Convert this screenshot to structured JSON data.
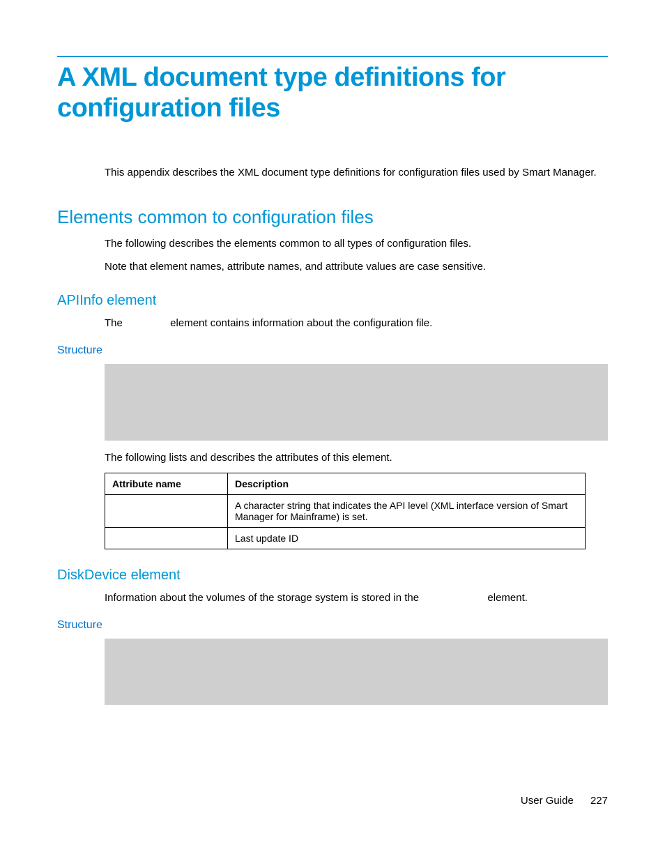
{
  "title": "A XML document type definitions for configuration files",
  "intro": "This appendix describes the XML document type definitions for configuration files used by Smart Manager.",
  "section1": {
    "heading": "Elements common to configuration files",
    "p1": "The following describes the elements common to all types of configuration files.",
    "p2": "Note that element names, attribute names, and attribute values are case sensitive."
  },
  "apiinfo": {
    "heading": "APIInfo element",
    "sentence_pre": "The ",
    "sentence_post": " element contains information about the configuration file.",
    "structure_label": "Structure",
    "attr_intro": "The following lists and describes the attributes of this element.",
    "table": {
      "col1": "Attribute name",
      "col2": "Description",
      "rows": [
        {
          "name": "",
          "desc": "A character string that indicates the API level (XML interface version of Smart Manager for Mainframe) is set."
        },
        {
          "name": "",
          "desc": "Last update ID"
        }
      ]
    }
  },
  "diskdevice": {
    "heading": "DiskDevice element",
    "sentence_pre": "Information about the volumes of the storage system is stored in the ",
    "sentence_post": " element.",
    "structure_label": "Structure"
  },
  "footer": {
    "label": "User Guide",
    "page": "227"
  }
}
